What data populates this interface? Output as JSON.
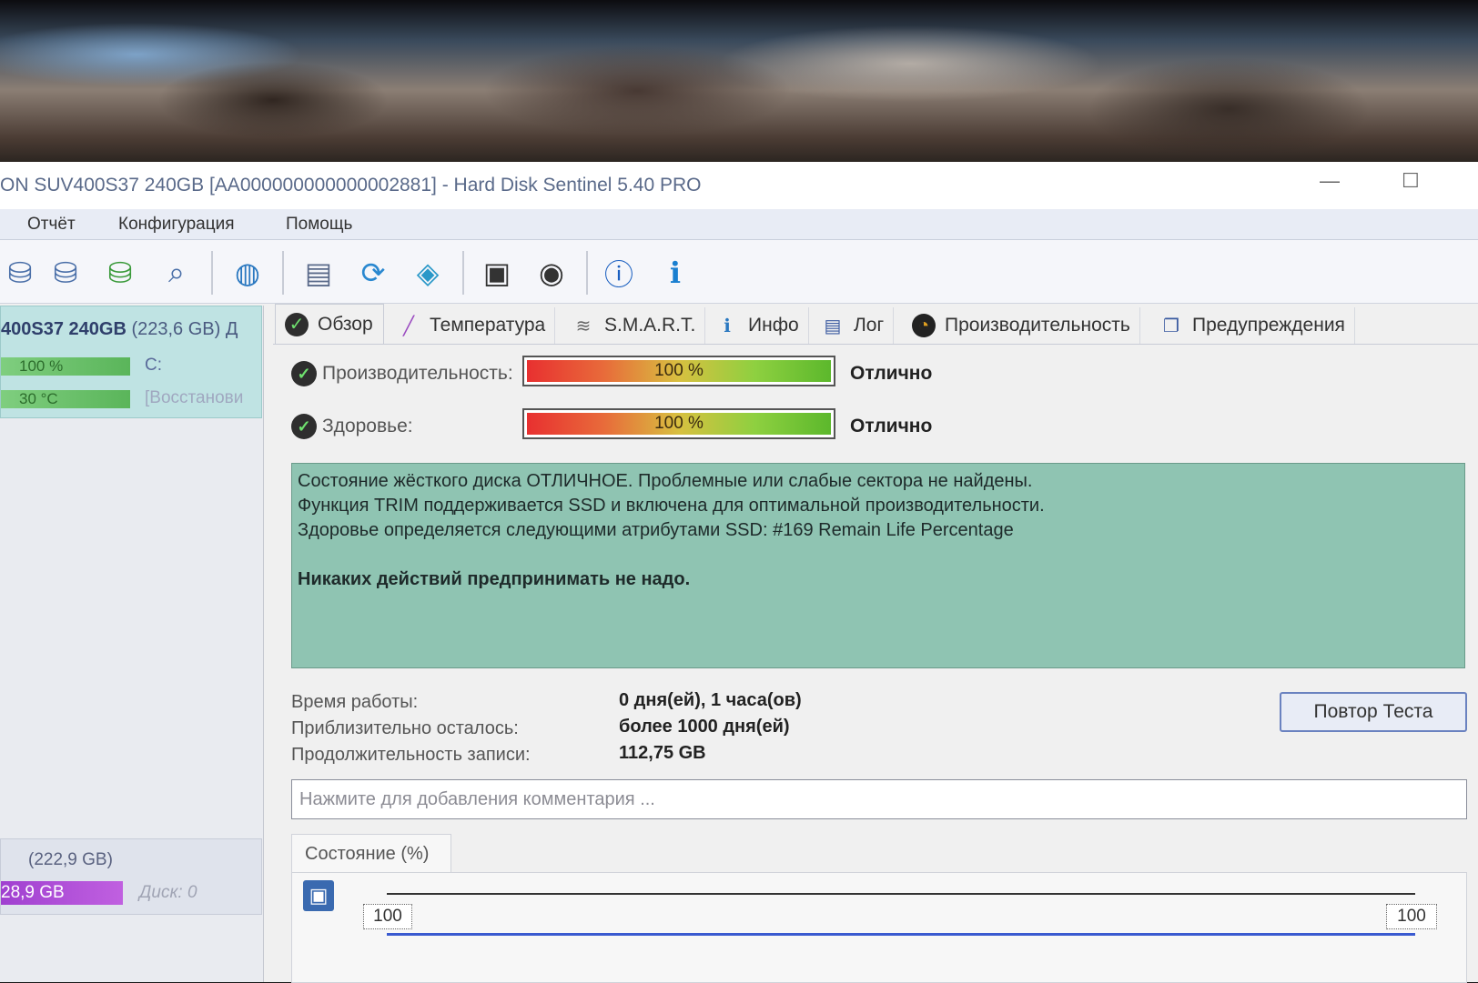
{
  "window": {
    "title": "ON SUV400S37 240GB [AA000000000000002881]  -  Hard Disk Sentinel 5.40 PRO",
    "minimize_symbol": "—",
    "maximize_symbol": "☐"
  },
  "menu": {
    "items": [
      "Отчёт",
      "Конфигурация",
      "Помощь"
    ]
  },
  "toolbar": {
    "icons": [
      "disk-test-icon",
      "disk-icon",
      "disk-check-icon",
      "disk-scan-icon",
      "globe-icon",
      "report-icon",
      "refresh-icon",
      "network-icon",
      "monitor-icon",
      "sound-icon",
      "help-icon",
      "info-icon"
    ]
  },
  "left_panel": {
    "disk_name": "400S37 240GB",
    "disk_size": "(223,6 GB)",
    "disk_suffix": "Д",
    "health_value": "100 %",
    "health_label": "C:",
    "temp_value": "30 °C",
    "temp_label": "[Восстанови",
    "volume_size": "(222,9 GB)",
    "volume_free": "28,9 GB",
    "volume_disk": "Диск: 0"
  },
  "tabs": [
    {
      "label": "Обзор",
      "icon": "check-icon"
    },
    {
      "label": "Температура",
      "icon": "thermometer-icon"
    },
    {
      "label": "S.M.A.R.T.",
      "icon": "smart-icon"
    },
    {
      "label": "Инфо",
      "icon": "info-icon"
    },
    {
      "label": "Лог",
      "icon": "log-icon"
    },
    {
      "label": "Производительность",
      "icon": "performance-icon"
    },
    {
      "label": "Предупреждения",
      "icon": "warnings-icon"
    }
  ],
  "overview": {
    "performance_label": "Производительность:",
    "performance_value": "100 %",
    "performance_percent": 100,
    "performance_status": "Отлично",
    "health_label": "Здоровье:",
    "health_value": "100 %",
    "health_percent": 100,
    "health_status": "Отлично",
    "message_lines": [
      "Состояние жёсткого диска ОТЛИЧНОЕ. Проблемные или слабые сектора не найдены.",
      "Функция TRIM поддерживается SSD и включена для оптимальной производительности.",
      "Здоровье определяется следующими атрибутами SSD: #169 Remain Life Percentage"
    ],
    "message_bold": "Никаких действий предпринимать не надо.",
    "uptime_label": "Время работы:",
    "uptime_value": "0 дня(ей), 1 часа(ов)",
    "remaining_label": "Приблизительно осталось:",
    "remaining_value": "более 1000 дня(ей)",
    "written_label": "Продолжительность записи:",
    "written_value": "112,75 GB",
    "retest_button": "Повтор Теста",
    "comment_placeholder": "Нажмите для добавления комментария ...",
    "status_tab": "Состояние (%)",
    "chart_left_value": "100",
    "chart_right_value": "100"
  }
}
